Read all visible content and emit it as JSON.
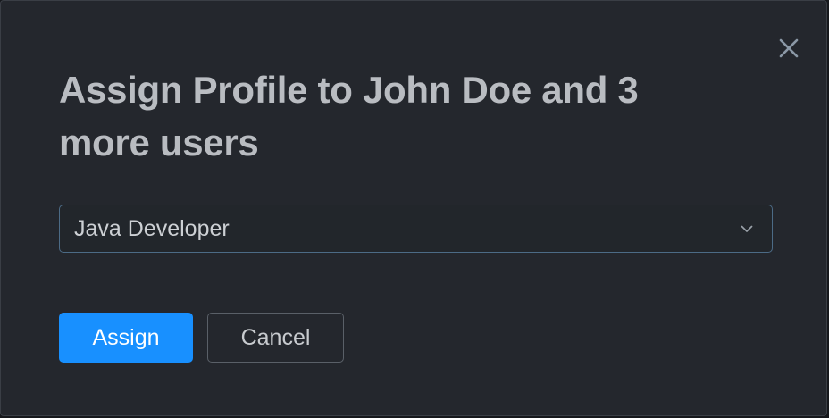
{
  "dialog": {
    "title": "Assign Profile to John Doe and 3 more users",
    "close_icon": "close-icon",
    "profile_select": {
      "selected": "Java Developer",
      "icon": "chevron-down-icon"
    },
    "buttons": {
      "assign_label": "Assign",
      "cancel_label": "Cancel"
    }
  },
  "colors": {
    "background": "#24272d",
    "primary": "#1890ff",
    "title_text": "#b9bcc1",
    "select_border": "#4c6b86"
  }
}
